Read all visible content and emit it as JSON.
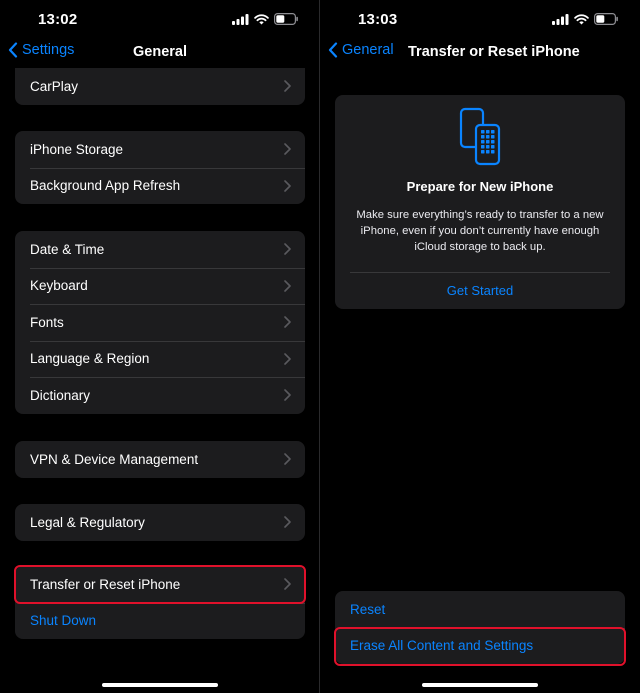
{
  "left": {
    "status": {
      "time": "13:02"
    },
    "nav": {
      "back_label": "Settings",
      "title": "General"
    },
    "groups": [
      [
        "CarPlay"
      ],
      [
        "iPhone Storage",
        "Background App Refresh"
      ],
      [
        "Date & Time",
        "Keyboard",
        "Fonts",
        "Language & Region",
        "Dictionary"
      ],
      [
        "VPN & Device Management"
      ],
      [
        "Legal & Regulatory"
      ],
      [
        "Transfer or Reset iPhone",
        "Shut Down"
      ]
    ]
  },
  "right": {
    "status": {
      "time": "13:03"
    },
    "nav": {
      "back_label": "General",
      "title": "Transfer or Reset iPhone"
    },
    "card": {
      "icon": "two-phones-icon",
      "title": "Prepare for New iPhone",
      "body": "Make sure everything’s ready to transfer to a new iPhone, even if you don’t currently have enough iCloud storage to back up.",
      "action": "Get Started"
    },
    "actions": [
      "Reset",
      "Erase All Content and Settings"
    ]
  },
  "colors": {
    "accent": "#0a84ff",
    "highlight": "#e0112b",
    "cell": "#1c1c1e",
    "background": "#000000"
  }
}
